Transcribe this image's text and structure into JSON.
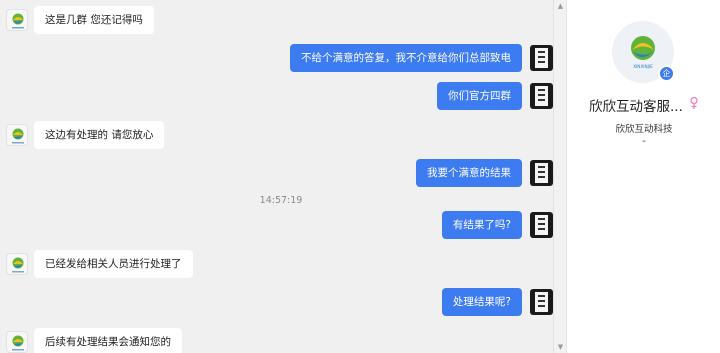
{
  "chat": {
    "messages": [
      {
        "direction": "in",
        "text": "这是几群 您还记得吗"
      },
      {
        "direction": "out",
        "text": "不给个满意的答复，我不介意给你们总部致电"
      },
      {
        "direction": "out",
        "text": "你们官方四群"
      },
      {
        "direction": "in",
        "text": "这边有处理的 请您放心"
      },
      {
        "direction": "out",
        "text": "我要个满意的结果"
      },
      {
        "direction": "out",
        "text": "有结果了吗?"
      },
      {
        "direction": "in",
        "text": "已经发给相关人员进行处理了"
      },
      {
        "direction": "out",
        "text": "处理结果呢?"
      },
      {
        "direction": "in",
        "text": "后续有处理结果会通知您的"
      }
    ],
    "timestamp": "14:57:19"
  },
  "scrollbar": {
    "up_icon": "▲",
    "down_icon": "▼"
  },
  "contact": {
    "name": "欣欣互动客服...",
    "company": "欣欣互动科技",
    "extra": "-",
    "enterprise_badge": "企",
    "gender_icon": "female-symbol-icon",
    "gender_color": "#f27fbf",
    "logo_caption": "XINXINJIE"
  },
  "colors": {
    "accent": "#3d7bf0",
    "logo_green": "#5fb33a",
    "logo_yellow": "#f0c020",
    "logo_blue": "#2e7fc0"
  }
}
